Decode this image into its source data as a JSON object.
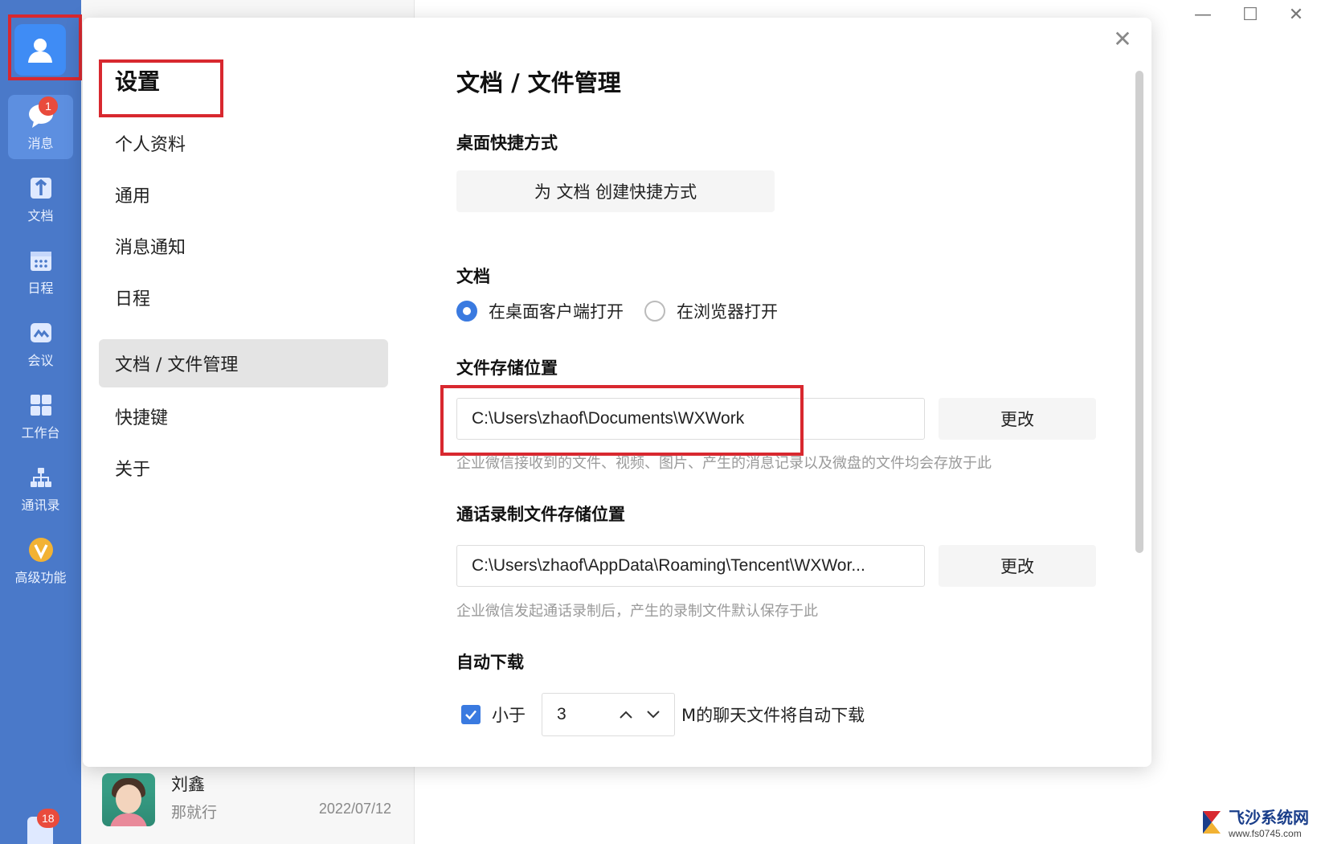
{
  "rail": {
    "items": [
      {
        "label": "消息",
        "badge": "1"
      },
      {
        "label": "文档"
      },
      {
        "label": "日程"
      },
      {
        "label": "会议"
      },
      {
        "label": "工作台"
      },
      {
        "label": "通讯录"
      },
      {
        "label": "高级功能"
      }
    ],
    "bottom_badge": "18"
  },
  "contact": {
    "name": "刘鑫",
    "message": "那就行",
    "date": "2022/07/12"
  },
  "settings": {
    "title": "设置",
    "nav": [
      "个人资料",
      "通用",
      "消息通知",
      "日程",
      "文档 / 文件管理",
      "快捷键",
      "关于"
    ],
    "active_nav": "文档 / 文件管理"
  },
  "content": {
    "title": "文档 / 文件管理",
    "shortcut": {
      "heading": "桌面快捷方式",
      "button": "为 文档 创建快捷方式"
    },
    "docs": {
      "heading": "文档",
      "options": [
        "在桌面客户端打开",
        "在浏览器打开"
      ],
      "selected": "在桌面客户端打开"
    },
    "storage": {
      "heading": "文件存储位置",
      "path": "C:\\Users\\zhaof\\Documents\\WXWork",
      "change": "更改",
      "hint": "企业微信接收到的文件、视频、图片、产生的消息记录以及微盘的文件均会存放于此"
    },
    "recording": {
      "heading": "通话录制文件存储位置",
      "path": "C:\\Users\\zhaof\\AppData\\Roaming\\Tencent\\WXWor...",
      "change": "更改",
      "hint": "企业微信发起通话录制后，产生的录制文件默认保存于此"
    },
    "auto_download": {
      "heading": "自动下载",
      "checked": true,
      "prefix": "小于",
      "value": "3",
      "suffix": "M的聊天文件将自动下载"
    }
  },
  "window": {
    "minimize": "—",
    "maximize": "☐",
    "close": "✕",
    "dialog_close": "✕"
  },
  "watermark": {
    "title": "飞沙系统网",
    "url": "www.fs0745.com"
  },
  "colors": {
    "rail": "#4a79c9",
    "accent": "#3a7ae0",
    "highlight": "#d8282f",
    "badge": "#e94b3c"
  }
}
